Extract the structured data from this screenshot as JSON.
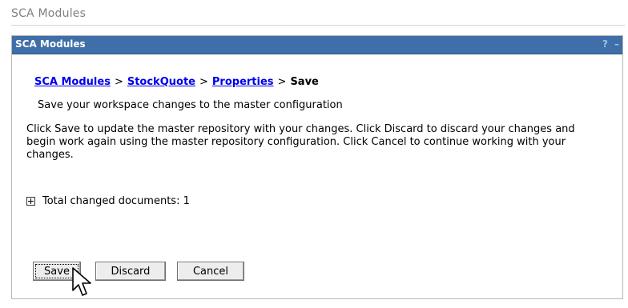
{
  "page": {
    "title": "SCA Modules"
  },
  "portlet": {
    "title": "SCA Modules",
    "help_icon": "?",
    "minimize_icon": "–"
  },
  "breadcrumb": {
    "items": [
      "SCA Modules",
      "StockQuote",
      "Properties"
    ],
    "current": "Save",
    "separator": ">"
  },
  "content": {
    "subtitle": "Save your workspace changes to the master configuration",
    "description": "Click Save to update the master repository with your changes. Click Discard to discard your changes and begin work again using the master repository configuration. Click Cancel to continue working with your changes.",
    "changed_docs": "Total changed documents: 1"
  },
  "buttons": {
    "save": "Save",
    "discard": "Discard",
    "cancel": "Cancel"
  },
  "colors": {
    "titlebar": "#3f6ea8",
    "link": "#0000ee"
  }
}
